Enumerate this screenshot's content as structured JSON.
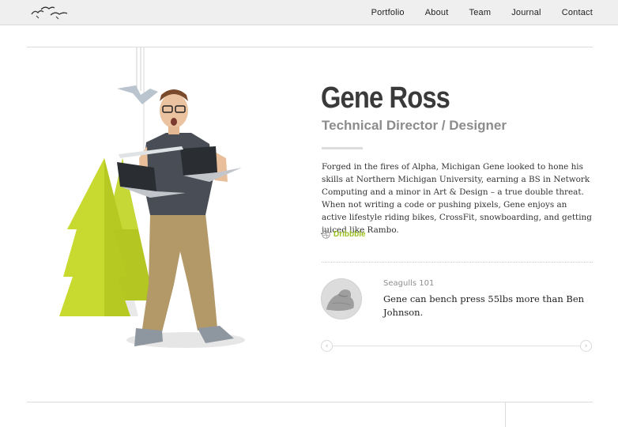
{
  "nav": {
    "logo_icon": "seagulls-logo-icon",
    "items": [
      "Portfolio",
      "About",
      "Team",
      "Journal",
      "Contact"
    ]
  },
  "profile": {
    "name": "Gene Ross",
    "role": "Technical Director / Designer",
    "bio": "Forged in the fires of Alpha, Michigan Gene looked to hone his skills at Northern Michigan University, earning a BS in Network Computing and a minor in Art & Design – a true double threat. When not writing a code or pushing pixels, Gene enjoys an active lifestyle riding bikes, CrossFit, snowboarding, and getting juiced like Rambo.",
    "link_label": "Dribbble",
    "link_icon": "dribbble-icon"
  },
  "fact": {
    "title": "Seagulls 101",
    "text": "Gene can bench press 55lbs more than Ben Johnson.",
    "avatar_icon": "flexed-bicep-icon"
  },
  "slider": {
    "prev_icon": "chevron-left-icon",
    "next_icon": "chevron-right-icon",
    "prev_glyph": "‹",
    "next_glyph": "›"
  },
  "colors": {
    "accent_green": "#9bc021",
    "tree_green": "#c3d52a",
    "nav_bg": "#efefef"
  }
}
